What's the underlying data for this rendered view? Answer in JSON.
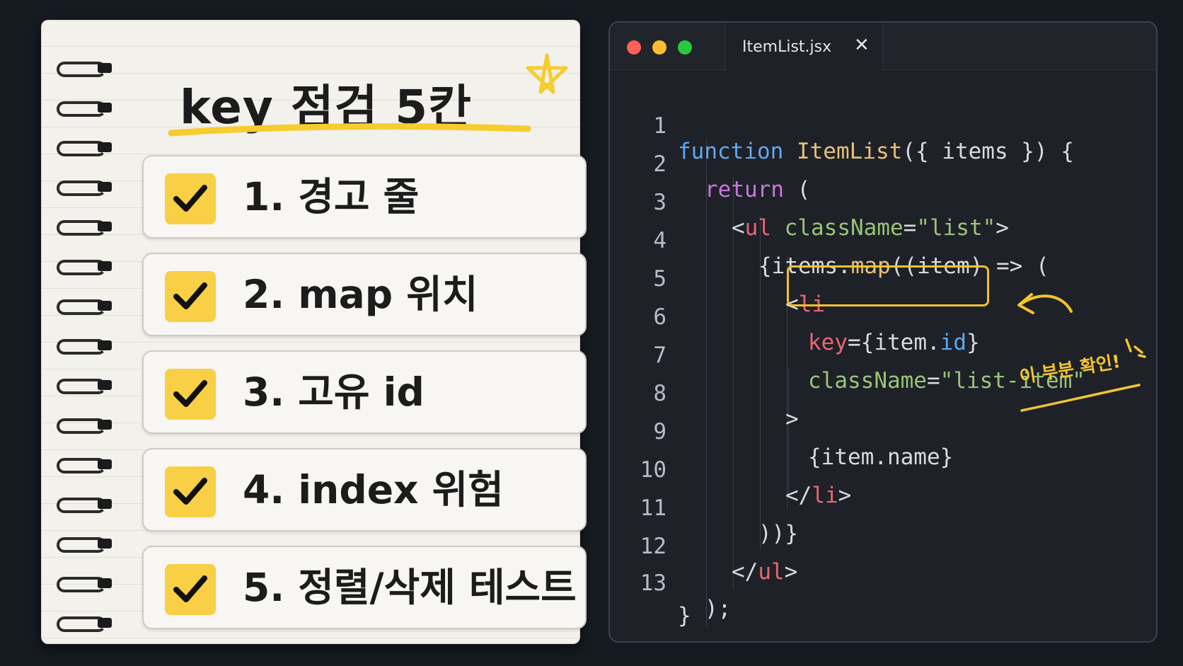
{
  "notebook": {
    "title": "key 점검 5칸",
    "items": [
      {
        "label": "1.  경고 줄",
        "checked": true
      },
      {
        "label": "2.  map 위치",
        "checked": true
      },
      {
        "label": "3.  고유 id",
        "checked": true
      },
      {
        "label": "4.  index 위험",
        "checked": true
      },
      {
        "label": "5.  정렬/삭제 테스트",
        "checked": true
      }
    ]
  },
  "editor": {
    "window_buttons": [
      "close",
      "minimize",
      "maximize"
    ],
    "tab": {
      "label": "ItemList.jsx",
      "close": "✕"
    },
    "line_numbers": [
      "1",
      "2",
      "3",
      "4",
      "5",
      "6",
      "7",
      "8",
      "9",
      "10",
      "11",
      "12",
      "13"
    ],
    "code": {
      "l1": {
        "kw": "function",
        "fn": "ItemList",
        "rest": "({ items }) {"
      },
      "l2": {
        "kw": "return",
        "rest": " ("
      },
      "l3": {
        "open": "<",
        "tag": "ul",
        "attr": " className",
        "eq": "=",
        "str": "\"list\"",
        "close": ">"
      },
      "l4": {
        "a": "{items.",
        "fn": "map",
        "b": "((item) => ("
      },
      "l5": {
        "open": "<",
        "tag": "li"
      },
      "l6": {
        "attr": "key",
        "a": "={item.",
        "prop": "id",
        "b": "}"
      },
      "l7": {
        "attr": "className",
        "eq": "=",
        "str": "\"list-item\""
      },
      "l8": {
        "text": ">"
      },
      "l9": {
        "text": "{item.name}"
      },
      "l10": {
        "open": "</",
        "tag": "li",
        "close": ">"
      },
      "l11": {
        "text": "))}"
      },
      "l12": {
        "open": "</",
        "tag": "ul",
        "close": ">"
      },
      "l13": {
        "text": ");"
      },
      "l14": {
        "text": "}"
      }
    },
    "annotation": "이 부분 확인!",
    "colors": {
      "highlight": "#f2c230",
      "checkbox": "#f8cf45",
      "close_dot": "#ff5f57",
      "minimize_dot": "#febc2e",
      "maximize_dot": "#28c840"
    }
  }
}
